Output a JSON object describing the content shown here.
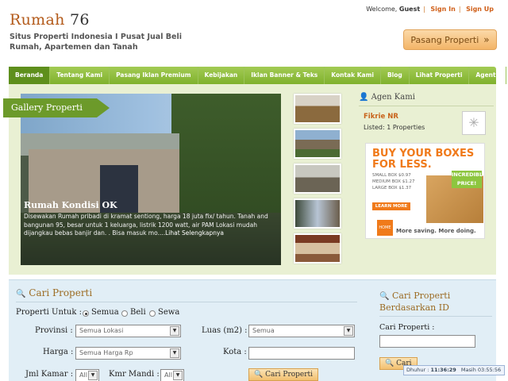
{
  "header": {
    "logo_text": "Rumah",
    "logo_num": "76",
    "tagline": "Situs Properti Indonesia I Pusat Jual Beli Rumah, Apartemen dan Tanah",
    "welcome": "Welcome,",
    "guest": "Guest",
    "sign_in": "Sign In",
    "sign_up": "Sign Up",
    "pasang_button": "Pasang Properti"
  },
  "nav": {
    "items": [
      "Beranda",
      "Tentang Kami",
      "Pasang Iklan Premium",
      "Kebijakan",
      "Iklan Banner & Teks",
      "Kontak Kami",
      "Blog",
      "Lihat Properti",
      "Agents"
    ]
  },
  "gallery": {
    "tag": "Gallery Properti",
    "title": "Rumah Kondisi OK",
    "description": "Disewakan Rumah pribadi di kramat sentiong, harga 18 juta fix/ tahun. Tanah and bangunan 95, besar untuk 1 keluarga, listrik 1200 watt, air PAM Lokasi mudah dijangkau bebas banjir dan. . Bisa masuk mo....",
    "more": "Lihat Selengkapnya"
  },
  "agen": {
    "title": "Agen Kami",
    "name": "Fikrie NR",
    "listed": "Listed: 1 Properties"
  },
  "ad": {
    "headline": "BUY YOUR BOXES FOR LESS.",
    "small": "SMALL BOX $0.97",
    "medium": "MEDIUM BOX $1.27",
    "large": "LARGE BOX $1.37",
    "learn": "LEARN MORE",
    "badge": "INCREDIBLE PRICE!",
    "logo": "HOME DEPOT",
    "footer": "More saving. More doing."
  },
  "search": {
    "title": "Cari Properti",
    "properti_untuk": "Properti Untuk :",
    "radio_semua": "Semua",
    "radio_beli": "Beli",
    "radio_sewa": "Sewa",
    "provinsi_label": "Provinsi :",
    "provinsi_value": "Semua Lokasi",
    "luas_label": "Luas (m2) :",
    "luas_value": "Semua",
    "harga_label": "Harga :",
    "harga_value": "Semua Harga Rp",
    "kota_label": "Kota :",
    "kamar_label": "Jml Kamar :",
    "kamar_value": "All",
    "mandi_label": "Kmr Mandi :",
    "mandi_value": "All",
    "button": "Cari Properti"
  },
  "search_id": {
    "title": "Cari Properti Berdasarkan ID",
    "label": "Cari Properti :",
    "button": "Cari"
  },
  "clock": {
    "label": "Dhuhur :",
    "time": "11:36:29",
    "sub": "Masih 03:55:56"
  },
  "colors": {
    "nav_green": "#7fb12d",
    "accent_orange": "#c8621a",
    "panel_green": "#e9f0d3",
    "search_blue": "#e1eef6"
  }
}
